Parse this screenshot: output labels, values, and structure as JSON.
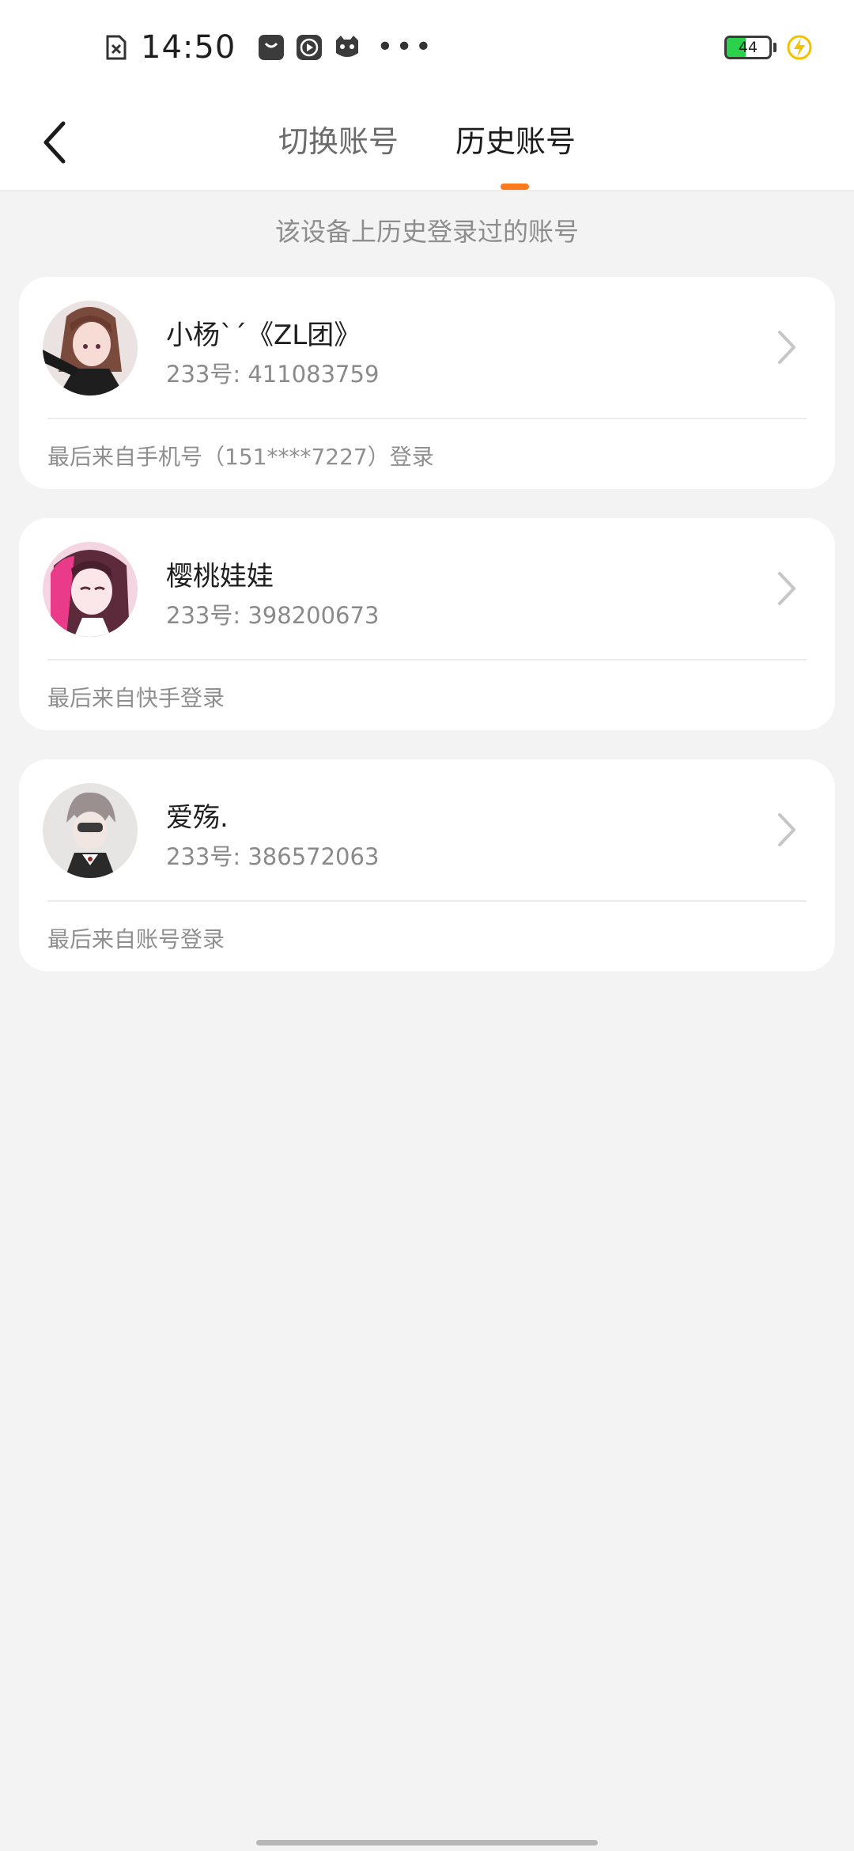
{
  "status_bar": {
    "time": "14:50",
    "battery_level": "44",
    "icons": [
      "no-sim-icon",
      "app-bag-icon",
      "play-icon",
      "cat-icon",
      "more-dots-icon",
      "charging-icon"
    ]
  },
  "header": {
    "tabs": [
      {
        "label": "切换账号",
        "active": false
      },
      {
        "label": "历史账号",
        "active": true
      }
    ],
    "accent_color": "#ff7a1a"
  },
  "subtitle": "该设备上历史登录过的账号",
  "accounts": [
    {
      "name": "小杨ˋˊ《ZL团》",
      "id": "233号: 411083759",
      "login": "最后来自手机号（151****7227）登录"
    },
    {
      "name": "樱桃娃娃",
      "id": "233号: 398200673",
      "login": "最后来自快手登录"
    },
    {
      "name": "爱殇.",
      "id": "233号: 386572063",
      "login": "最后来自账号登录"
    }
  ]
}
